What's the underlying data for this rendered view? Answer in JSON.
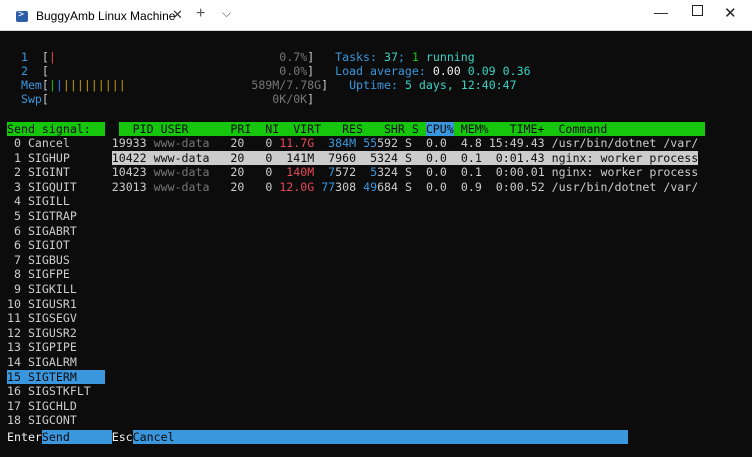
{
  "window": {
    "tab_title": "BuggyAmb Linux Machine",
    "close_glyph": "✕",
    "newtab_glyph": "+",
    "menu_glyph": "⌵",
    "min_glyph": "—",
    "close_win_glyph": "✕"
  },
  "meters": {
    "cpu1": {
      "label": "1",
      "bar": "|",
      "pct": "0.7%"
    },
    "cpu2": {
      "label": "2",
      "bar": "",
      "pct": "0.0%"
    },
    "mem": {
      "label": "Mem",
      "bar_green": "|",
      "bar_blue": "|",
      "bar_yellow": "|||||||||",
      "value": "589M/7.78G"
    },
    "swp": {
      "label": "Swp",
      "value": "0K/0K"
    }
  },
  "summary": {
    "tasks_label": "Tasks:",
    "tasks": "37",
    "sep": ";",
    "running": "1",
    "running_label": "running",
    "load_label": "Load average:",
    "load1": "0.00",
    "load5": "0.09",
    "load15": "0.36",
    "uptime_label": "Uptime:",
    "uptime": "5 days, 12:40:47"
  },
  "signal_panel": {
    "title": "Send signal:",
    "items": [
      {
        "num": "0",
        "name": "Cancel"
      },
      {
        "num": "1",
        "name": "SIGHUP"
      },
      {
        "num": "2",
        "name": "SIGINT"
      },
      {
        "num": "3",
        "name": "SIGQUIT"
      },
      {
        "num": "4",
        "name": "SIGILL"
      },
      {
        "num": "5",
        "name": "SIGTRAP"
      },
      {
        "num": "6",
        "name": "SIGABRT"
      },
      {
        "num": "6",
        "name": "SIGIOT"
      },
      {
        "num": "7",
        "name": "SIGBUS"
      },
      {
        "num": "8",
        "name": "SIGFPE"
      },
      {
        "num": "9",
        "name": "SIGKILL"
      },
      {
        "num": "10",
        "name": "SIGUSR1"
      },
      {
        "num": "11",
        "name": "SIGSEGV"
      },
      {
        "num": "12",
        "name": "SIGUSR2"
      },
      {
        "num": "13",
        "name": "SIGPIPE"
      },
      {
        "num": "14",
        "name": "SIGALRM"
      },
      {
        "num": "15",
        "name": "SIGTERM"
      },
      {
        "num": "16",
        "name": "SIGSTKFLT"
      },
      {
        "num": "17",
        "name": "SIGCHLD"
      },
      {
        "num": "18",
        "name": "SIGCONT"
      }
    ],
    "selected_index": 16
  },
  "process_table": {
    "columns": [
      "PID",
      "USER",
      "PRI",
      "NI",
      "VIRT",
      "RES",
      "SHR",
      "S",
      "CPU%",
      "MEM%",
      "TIME+",
      "Command"
    ],
    "sort_column": "CPU%",
    "rows": [
      {
        "pid": "19933",
        "user": "www-data",
        "pri": "20",
        "ni": "0",
        "virt_hi": "11.7G",
        "res_hi": "384M",
        "shr_hi": "55",
        "shr_lo": "592",
        "s": "S",
        "cpu": "0.0",
        "mem": "4.8",
        "time": "15:49.43",
        "cmd": "/usr/bin/dotnet /var/"
      },
      {
        "pid": "10422",
        "user": "www-data",
        "pri": "20",
        "ni": "0",
        "virt": "141M",
        "res": "7960",
        "shr": "5324",
        "s": "S",
        "cpu": "0.0",
        "mem": "0.1",
        "time": "0:01.43",
        "cmd": "nginx: worker process"
      },
      {
        "pid": "10423",
        "user": "www-data",
        "pri": "20",
        "ni": "0",
        "virt_hi": "140M",
        "res_hi": "7",
        "res_lo": "572",
        "shr_hi": "5",
        "shr_lo": "324",
        "s": "S",
        "cpu": "0.0",
        "mem": "0.1",
        "time": "0:00.01",
        "cmd": "nginx: worker process"
      },
      {
        "pid": "23013",
        "user": "www-data",
        "pri": "20",
        "ni": "0",
        "virt_hi": "12.0G",
        "res_hi": "77",
        "res_lo": "308",
        "shr_hi": "49",
        "shr_lo": "684",
        "s": "S",
        "cpu": "0.0",
        "mem": "0.9",
        "time": "0:00.52",
        "cmd": "/usr/bin/dotnet /var/"
      }
    ],
    "selected_index": 1
  },
  "footer": {
    "enter_key": "Enter",
    "enter_label": "Send",
    "esc_key": "Esc",
    "esc_label": "Cancel"
  }
}
